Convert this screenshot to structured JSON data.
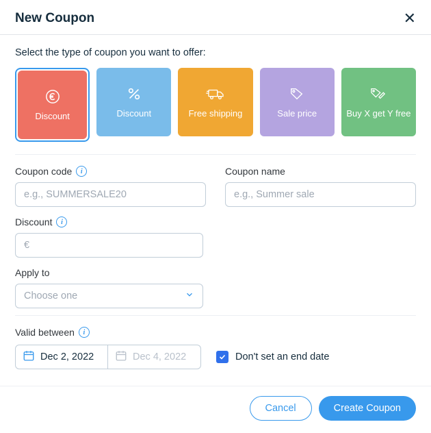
{
  "header": {
    "title": "New Coupon"
  },
  "prompt": "Select the type of coupon you want to offer:",
  "tiles": {
    "euro": "Discount",
    "percent": "Discount",
    "shipping": "Free shipping",
    "sale": "Sale price",
    "bogo": "Buy X get Y free"
  },
  "fields": {
    "code_label": "Coupon code",
    "code_placeholder": "e.g., SUMMERSALE20",
    "name_label": "Coupon name",
    "name_placeholder": "e.g., Summer sale",
    "discount_label": "Discount",
    "discount_prefix": "€",
    "apply_label": "Apply to",
    "apply_placeholder": "Choose one",
    "valid_label": "Valid between",
    "start_date": "Dec 2, 2022",
    "end_date": "Dec 4, 2022",
    "no_end_label": "Don't set an end date",
    "no_end_checked": true
  },
  "footer": {
    "cancel": "Cancel",
    "create": "Create Coupon"
  },
  "colors": {
    "primary": "#3899ec"
  }
}
